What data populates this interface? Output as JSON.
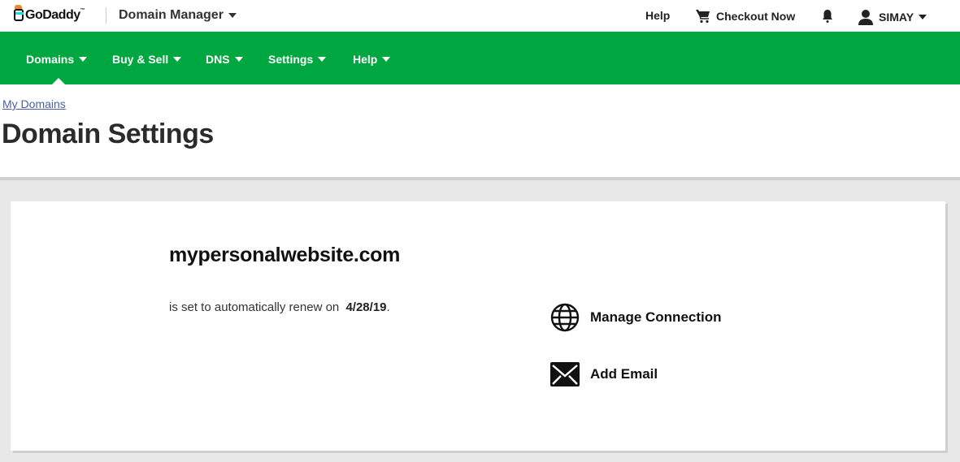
{
  "topbar": {
    "logo_text": "GoDaddy",
    "logo_tm": "™",
    "app_title": "Domain Manager",
    "help_label": "Help",
    "checkout_label": "Checkout Now",
    "user_name": "SIMAY"
  },
  "nav": {
    "items": [
      {
        "label": "Domains",
        "active": true
      },
      {
        "label": "Buy & Sell"
      },
      {
        "label": "DNS"
      },
      {
        "label": "Settings"
      },
      {
        "label": "Help"
      }
    ]
  },
  "page": {
    "breadcrumb": "My Domains",
    "title": "Domain Settings"
  },
  "domain": {
    "name": "mypersonalwebsite.com",
    "renew_text": "is set to automatically renew on",
    "renew_date": "4/28/19",
    "renew_suffix": "."
  },
  "actions": {
    "manage_connection": "Manage Connection",
    "add_email": "Add Email"
  },
  "colors": {
    "brand_green": "#00a63f",
    "link": "#4a5fa8"
  }
}
